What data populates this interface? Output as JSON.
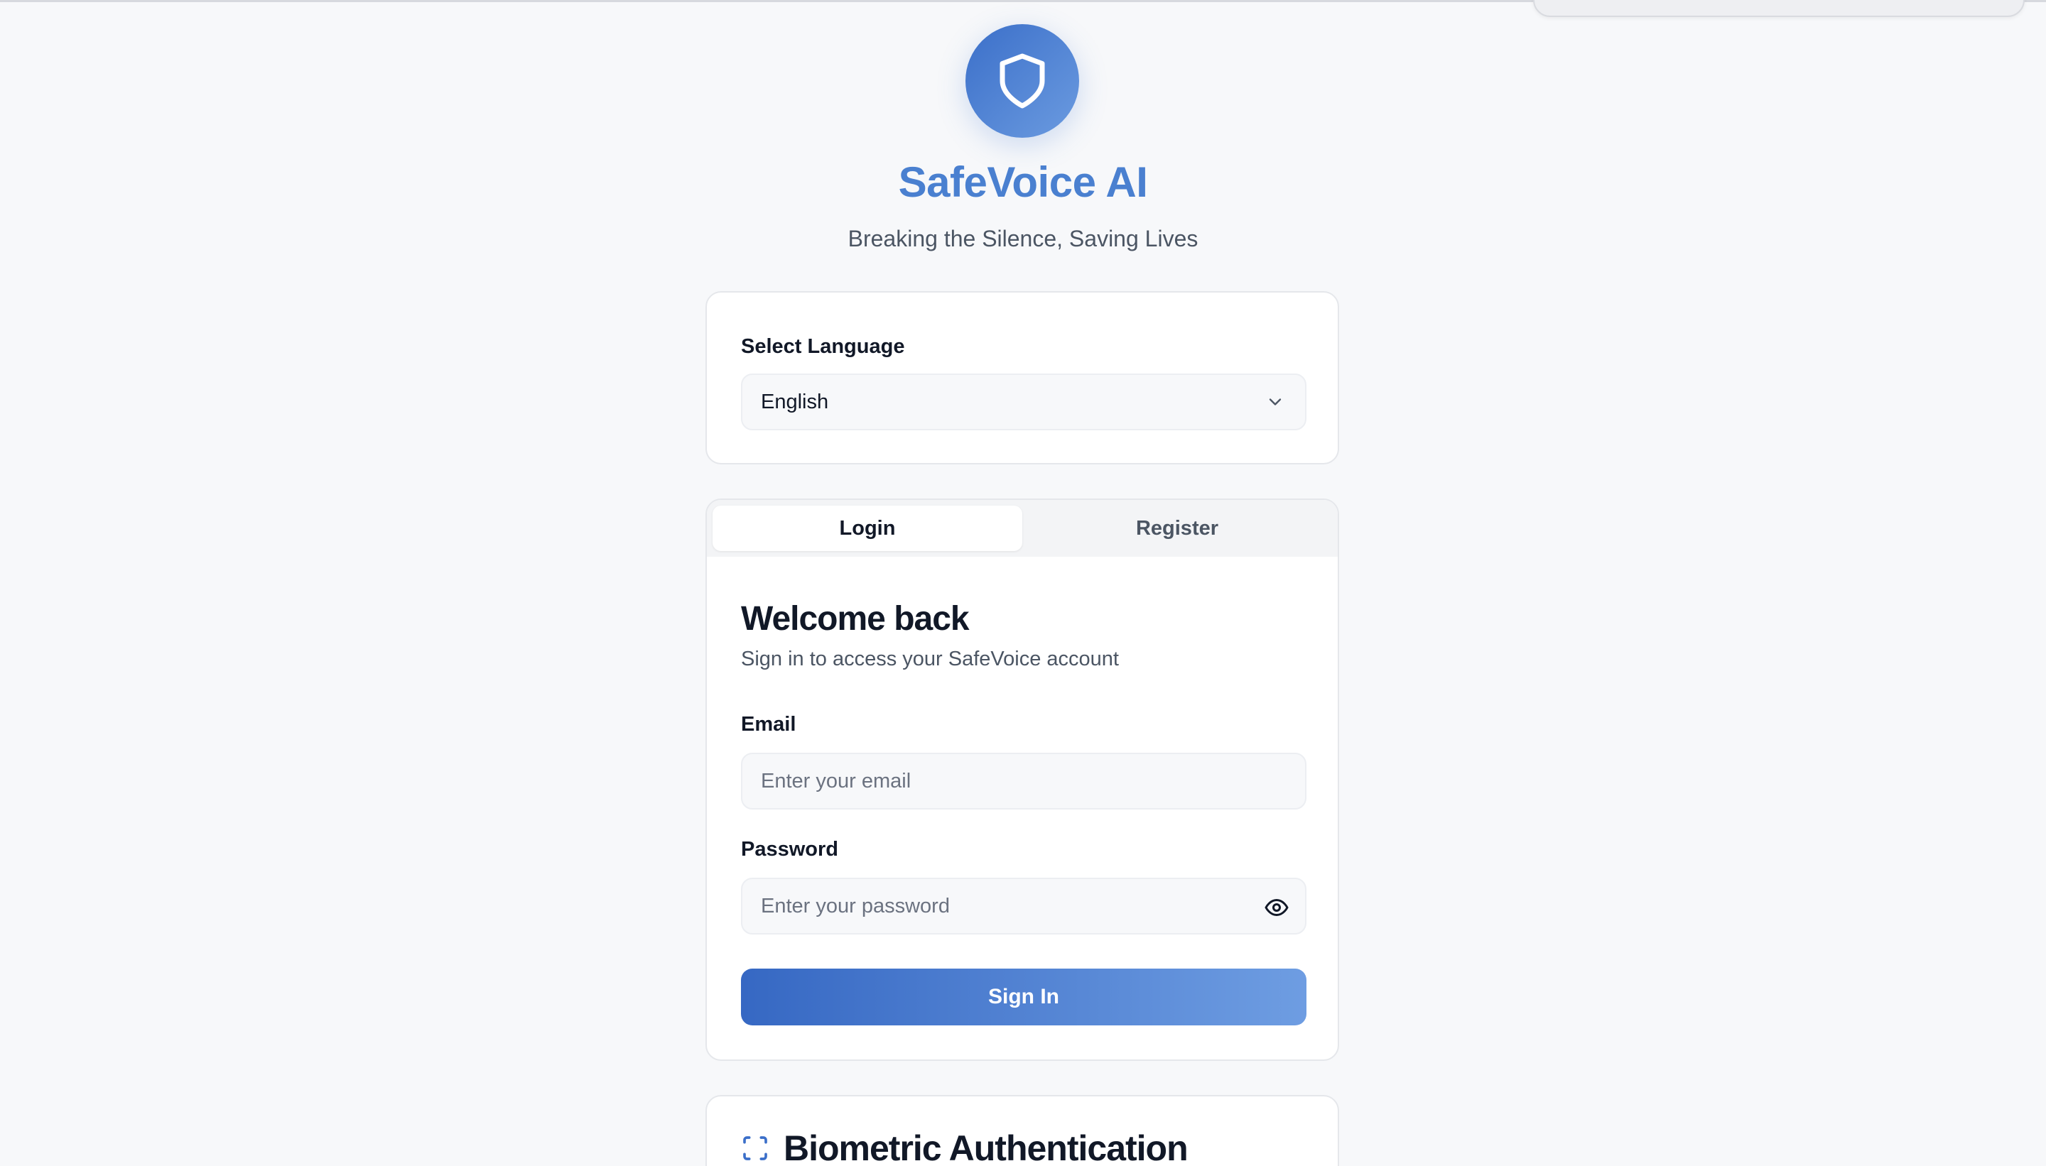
{
  "app": {
    "title": "SafeVoice AI",
    "tagline": "Breaking the Silence, Saving Lives",
    "logo_icon": "shield-icon",
    "accent_color": "#4a80d0"
  },
  "language": {
    "label": "Select Language",
    "selected": "English",
    "icon": "chevron-down-icon"
  },
  "auth": {
    "tabs": [
      {
        "label": "Login",
        "active": true
      },
      {
        "label": "Register",
        "active": false
      }
    ],
    "heading": "Welcome back",
    "subheading": "Sign in to access your SafeVoice account",
    "email": {
      "label": "Email",
      "placeholder": "Enter your email",
      "value": ""
    },
    "password": {
      "label": "Password",
      "placeholder": "Enter your password",
      "value": "",
      "toggle_icon": "eye-icon"
    },
    "submit_label": "Sign In"
  },
  "biometric": {
    "title": "Biometric Authentication",
    "icon": "scan-icon"
  }
}
